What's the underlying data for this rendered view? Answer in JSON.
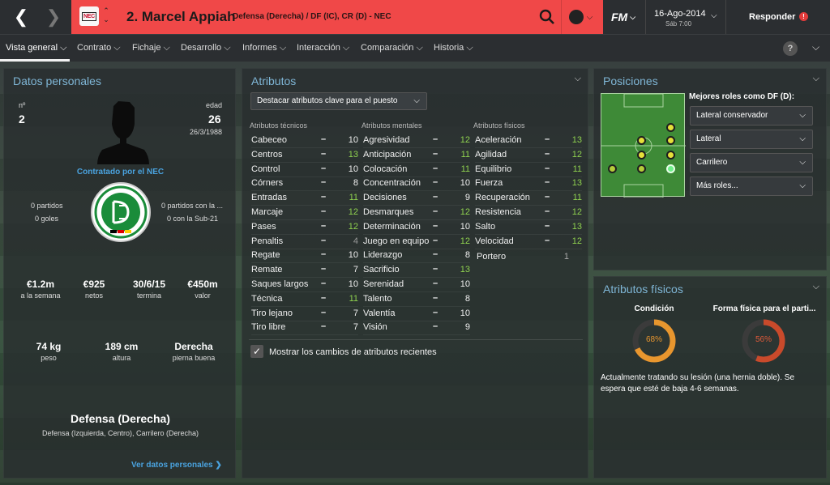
{
  "header": {
    "player_name": "2. Marcel Appiah",
    "position": "Defensa (Derecha) / DF (IC), CR (D) - NEC",
    "club_abbr": "NEC",
    "fm_label": "FM",
    "date": "16-Ago-2014",
    "day_time": "Sáb 7:00",
    "reply_label": "Responder",
    "reply_badge": "!"
  },
  "tabs": [
    "Vista general",
    "Contrato",
    "Fichaje",
    "Desarrollo",
    "Informes",
    "Interacción",
    "Comparación",
    "Historia"
  ],
  "help_label": "?",
  "personal": {
    "title": "Datos personales",
    "number_label": "nº",
    "number": "2",
    "age_label": "edad",
    "age": "26",
    "dob": "26/3/1988",
    "contracted": "Contratado por el NEC",
    "left_caps": "0 partidos",
    "left_goals": "0 goles",
    "right_caps": "0 partidos con la ...",
    "right_goals": "0 con la Sub-21",
    "stats1": [
      {
        "value": "€1.2m",
        "label": "a la semana"
      },
      {
        "value": "€925",
        "label": "netos"
      },
      {
        "value": "30/6/15",
        "label": "termina"
      },
      {
        "value": "€450m",
        "label": "valor"
      }
    ],
    "stats2": [
      {
        "value": "74 kg",
        "label": "peso"
      },
      {
        "value": "189 cm",
        "label": "altura"
      },
      {
        "value": "Derecha",
        "label": "pierna buena"
      }
    ],
    "main_position": "Defensa (Derecha)",
    "other_positions": "Defensa (Izquierda, Centro), Carrilero (Derecha)",
    "link": "Ver datos personales"
  },
  "attributes": {
    "title": "Atributos",
    "highlight_dropdown": "Destacar atributos clave para el puesto",
    "technical_title": "Atributos técnicos",
    "mental_title": "Atributos mentales",
    "physical_title": "Atributos físicos",
    "technical": [
      {
        "name": "Cabeceo",
        "value": "10",
        "key": false
      },
      {
        "name": "Centros",
        "value": "13",
        "key": true
      },
      {
        "name": "Control",
        "value": "10",
        "key": false
      },
      {
        "name": "Córners",
        "value": "8",
        "key": false
      },
      {
        "name": "Entradas",
        "value": "11",
        "key": true
      },
      {
        "name": "Marcaje",
        "value": "12",
        "key": true
      },
      {
        "name": "Pases",
        "value": "12",
        "key": true
      },
      {
        "name": "Penaltis",
        "value": "4",
        "key": false,
        "dim": true
      },
      {
        "name": "Regate",
        "value": "10",
        "key": false
      },
      {
        "name": "Remate",
        "value": "7",
        "key": false
      },
      {
        "name": "Saques largos",
        "value": "10",
        "key": false
      },
      {
        "name": "Técnica",
        "value": "11",
        "key": true
      },
      {
        "name": "Tiro lejano",
        "value": "7",
        "key": false
      },
      {
        "name": "Tiro libre",
        "value": "7",
        "key": false
      }
    ],
    "mental": [
      {
        "name": "Agresividad",
        "value": "12",
        "key": true
      },
      {
        "name": "Anticipación",
        "value": "11",
        "key": true
      },
      {
        "name": "Colocación",
        "value": "11",
        "key": true
      },
      {
        "name": "Concentración",
        "value": "10",
        "key": false
      },
      {
        "name": "Decisiones",
        "value": "9",
        "key": false
      },
      {
        "name": "Desmarques",
        "value": "12",
        "key": true
      },
      {
        "name": "Determinación",
        "value": "10",
        "key": false
      },
      {
        "name": "Juego en equipo",
        "value": "12",
        "key": true
      },
      {
        "name": "Liderazgo",
        "value": "8",
        "key": false
      },
      {
        "name": "Sacrificio",
        "value": "13",
        "key": true
      },
      {
        "name": "Serenidad",
        "value": "10",
        "key": false
      },
      {
        "name": "Talento",
        "value": "8",
        "key": false
      },
      {
        "name": "Valentía",
        "value": "10",
        "key": false
      },
      {
        "name": "Visión",
        "value": "9",
        "key": false
      }
    ],
    "physical": [
      {
        "name": "Aceleración",
        "value": "13",
        "key": true
      },
      {
        "name": "Agilidad",
        "value": "12",
        "key": true
      },
      {
        "name": "Equilibrio",
        "value": "11",
        "key": true
      },
      {
        "name": "Fuerza",
        "value": "13",
        "key": true
      },
      {
        "name": "Recuperación",
        "value": "11",
        "key": true
      },
      {
        "name": "Resistencia",
        "value": "12",
        "key": true
      },
      {
        "name": "Salto",
        "value": "13",
        "key": true
      },
      {
        "name": "Velocidad",
        "value": "12",
        "key": true
      }
    ],
    "goalkeeper": {
      "name": "Portero",
      "value": "1"
    },
    "checkbox_label": "Mostrar los cambios de atributos recientes",
    "checkbox_checked": true
  },
  "positions": {
    "title": "Posiciones",
    "roles_label": "Mejores roles como DF (D):",
    "roles": [
      "Lateral conservador",
      "Lateral",
      "Carrilero",
      "Más roles..."
    ]
  },
  "physical_panel": {
    "title": "Atributos físicos",
    "condition_label": "Condición",
    "condition_value": "68%",
    "condition_pct": 68,
    "fitness_label": "Forma física para el parti...",
    "fitness_value": "56%",
    "fitness_pct": 56,
    "injury_text": "Actualmente tratando su lesión (una hernia doble). Se espera que esté de baja 4-6 semanas."
  },
  "colors": {
    "header_red": "#f04848",
    "accent_blue": "#4aa3df",
    "key_green": "#8fd14f",
    "gauge_condition": "#e8962e",
    "gauge_fitness": "#c94a2b"
  }
}
